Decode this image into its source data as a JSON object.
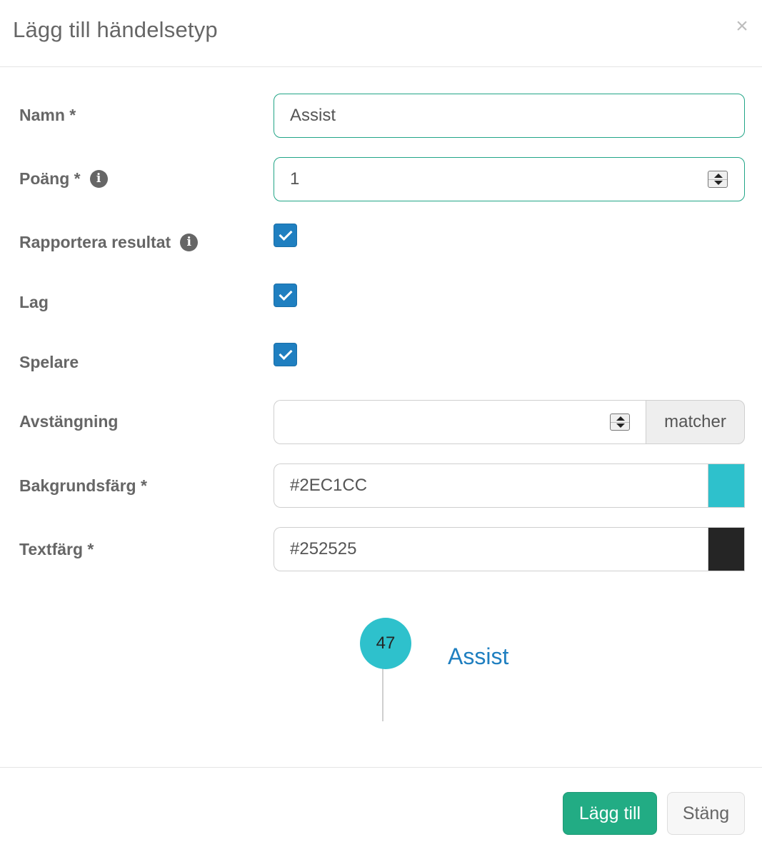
{
  "modal": {
    "title": "Lägg till händelsetyp",
    "close_label": "×"
  },
  "form": {
    "name": {
      "label": "Namn *",
      "value": "Assist"
    },
    "points": {
      "label": "Poäng *",
      "value": "1"
    },
    "report_result": {
      "label": "Rapportera resultat",
      "checked": true
    },
    "team": {
      "label": "Lag",
      "checked": true
    },
    "player": {
      "label": "Spelare",
      "checked": true
    },
    "suspension": {
      "label": "Avstängning",
      "value": "",
      "addon": "matcher"
    },
    "background_color": {
      "label": "Bakgrundsfärg *",
      "value": "#2EC1CC"
    },
    "text_color": {
      "label": "Textfärg *",
      "value": "#252525"
    }
  },
  "preview": {
    "number": "47",
    "name": "Assist",
    "circle_bg": "#2EC1CC",
    "circle_text": "#252525"
  },
  "footer": {
    "add_label": "Lägg till",
    "close_label": "Stäng"
  },
  "icons": {
    "info": "i"
  },
  "colors": {
    "primary": "#22ac84",
    "checkbox": "#1f7fc0",
    "focus_border": "#22a587"
  }
}
